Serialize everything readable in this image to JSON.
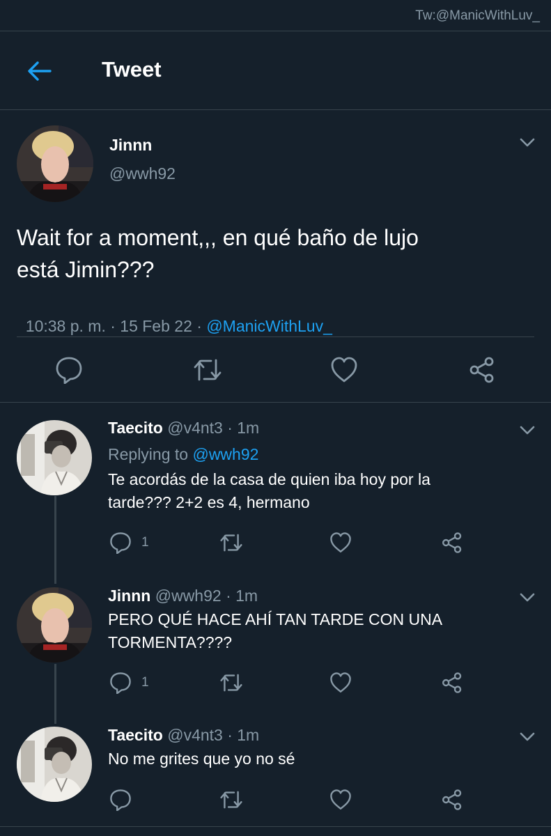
{
  "watermark": "Tw:@ManicWithLuv_",
  "header": {
    "title": "Tweet"
  },
  "main_tweet": {
    "name": "Jinnn",
    "handle": "@wwh92",
    "text_line1": "Wait for a moment,,, en qué baño de lujo",
    "text_line2": "está Jimin???",
    "time": "10:38 p. m. · 15 Feb 22 · ",
    "source": "@ManicWithLuv_"
  },
  "replies": [
    {
      "name": "Taecito",
      "meta": " @v4nt3 · 1m",
      "replying_prefix": "Replying to ",
      "replying_handle": "@wwh92",
      "text_line1": "Te acordás de la casa de quien iba hoy por la",
      "text_line2": "tarde??? 2+2 es 4, hermano",
      "reply_count": "1"
    },
    {
      "name": "Jinnn",
      "meta": " @wwh92 · 1m",
      "text_line1": "PERO QUÉ HACE AHÍ TAN TARDE CON UNA",
      "text_line2": "TORMENTA????",
      "reply_count": "1"
    },
    {
      "name": "Taecito",
      "meta": " @v4nt3 · 1m",
      "text_line1": "No me grites que yo no sé"
    }
  ],
  "colors": {
    "background": "#15202b",
    "divider": "#38444d",
    "accent": "#1da1f2",
    "muted": "#8899a6"
  },
  "icons": {
    "back": "arrow-left-icon",
    "caret": "chevron-down-icon",
    "reply": "reply-icon",
    "retweet": "retweet-icon",
    "like": "heart-icon",
    "share": "share-icon"
  }
}
